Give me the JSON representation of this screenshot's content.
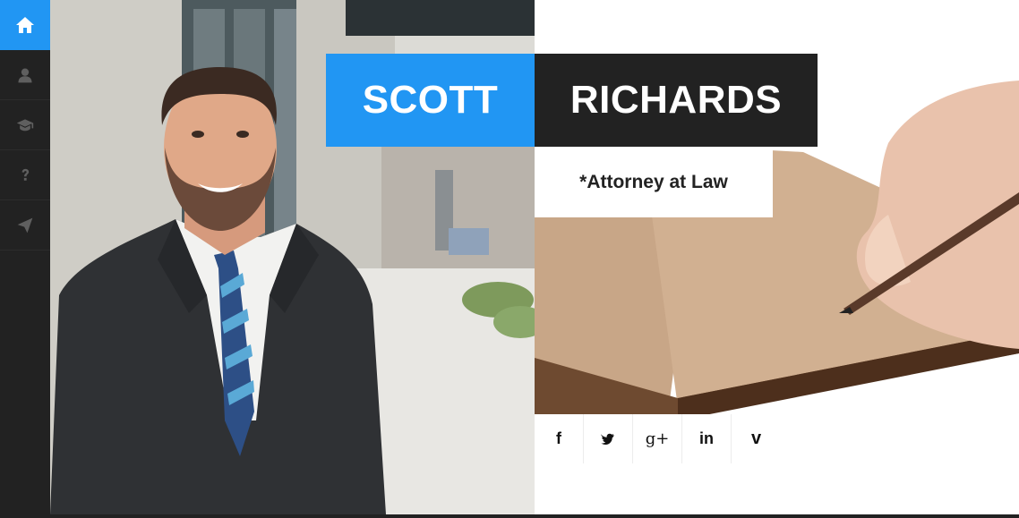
{
  "sidebar": {
    "items": [
      {
        "icon": "home-icon",
        "active": true
      },
      {
        "icon": "user-icon",
        "active": false
      },
      {
        "icon": "graduation-cap-icon",
        "active": false
      },
      {
        "icon": "question-icon",
        "active": false
      },
      {
        "icon": "paper-plane-icon",
        "active": false
      }
    ]
  },
  "hero": {
    "first_name": "SCOTT",
    "last_name": "RICHARDS",
    "title": "*Attorney at Law"
  },
  "social": {
    "items": [
      {
        "icon": "facebook-icon",
        "glyph": "f"
      },
      {
        "icon": "twitter-icon",
        "glyph": ""
      },
      {
        "icon": "google-plus-icon",
        "glyph": "g+"
      },
      {
        "icon": "linkedin-icon",
        "glyph": "in"
      },
      {
        "icon": "vimeo-icon",
        "glyph": "v"
      }
    ]
  },
  "colors": {
    "accent": "#2196f3",
    "dark": "#222222",
    "sidebar_icon": "#5f5f5f"
  }
}
